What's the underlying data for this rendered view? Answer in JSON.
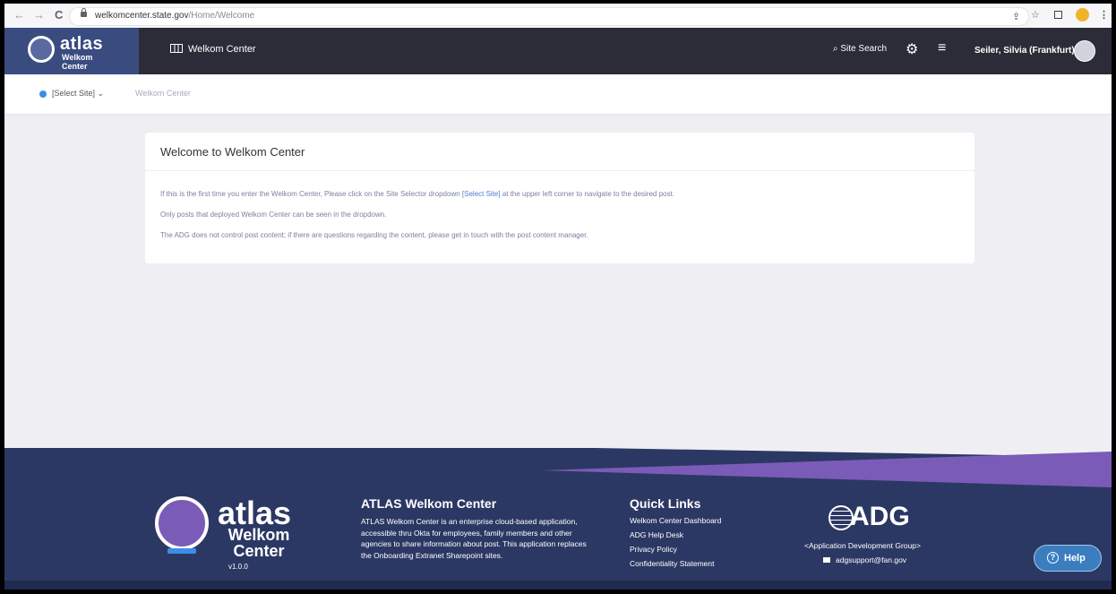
{
  "browser": {
    "url_domain": "welkomcenter.state.gov",
    "url_path": "/Home/Welcome",
    "back_glyph": "←",
    "forward_glyph": "→",
    "reload_glyph": "C",
    "share_glyph": "⇪",
    "star_glyph": "☆",
    "menu_glyph": "⋮"
  },
  "header": {
    "logo_title": "atlas",
    "logo_line1": "Welkom",
    "logo_line2": "Center",
    "app_title": "Welkom Center",
    "search_label": "Site Search",
    "gear_glyph": "⚙",
    "menu_glyph": "≡",
    "user_name": "Seiler, Silvia (Frankfurt)"
  },
  "subnav": {
    "site_selector": "[Select Site]",
    "chevron": "⌄",
    "breadcrumb": "Welkom Center"
  },
  "welcome": {
    "title": "Welcome to Welkom Center",
    "p1_before": "If this is the first time you enter the Welkom Center, Please click on the Site Selector dropdown ",
    "p1_link": "[Select Site]",
    "p1_after": " at the upper left corner to navigate to the desired post.",
    "p2": "Only posts that deployed Welkom Center can be seen in the dropdown.",
    "p3": "The ADG does not control post content; if there are questions regarding the content, please get in touch with the post content manager."
  },
  "footer": {
    "logo_title": "atlas",
    "logo_line1": "Welkom",
    "logo_line2": "Center",
    "version": "v1.0.0",
    "about_title": "ATLAS Welkom Center",
    "about_text": "ATLAS Welkom Center is an enterprise cloud-based application, accessible thru Okta for employees, family members and other agencies to share information about post. This application replaces the Onboarding Extranet Sharepoint sites.",
    "links_title": "Quick Links",
    "links": [
      "Welkom Center Dashboard",
      "ADG Help Desk",
      "Privacy Policy",
      "Confidentiality Statement"
    ],
    "adg_logo": "ADG",
    "adg_subtitle": "<Application Development Group>",
    "adg_email": "adgsupport@fan.gov"
  },
  "help": {
    "glyph": "?",
    "label": "Help"
  },
  "colors": {
    "header_bg": "#2c2c38",
    "logo_bg": "#3a4b80",
    "footer_bg": "#2c3864",
    "footer_accent": "#7b5bb8",
    "help_bg": "#3a7ec0"
  }
}
